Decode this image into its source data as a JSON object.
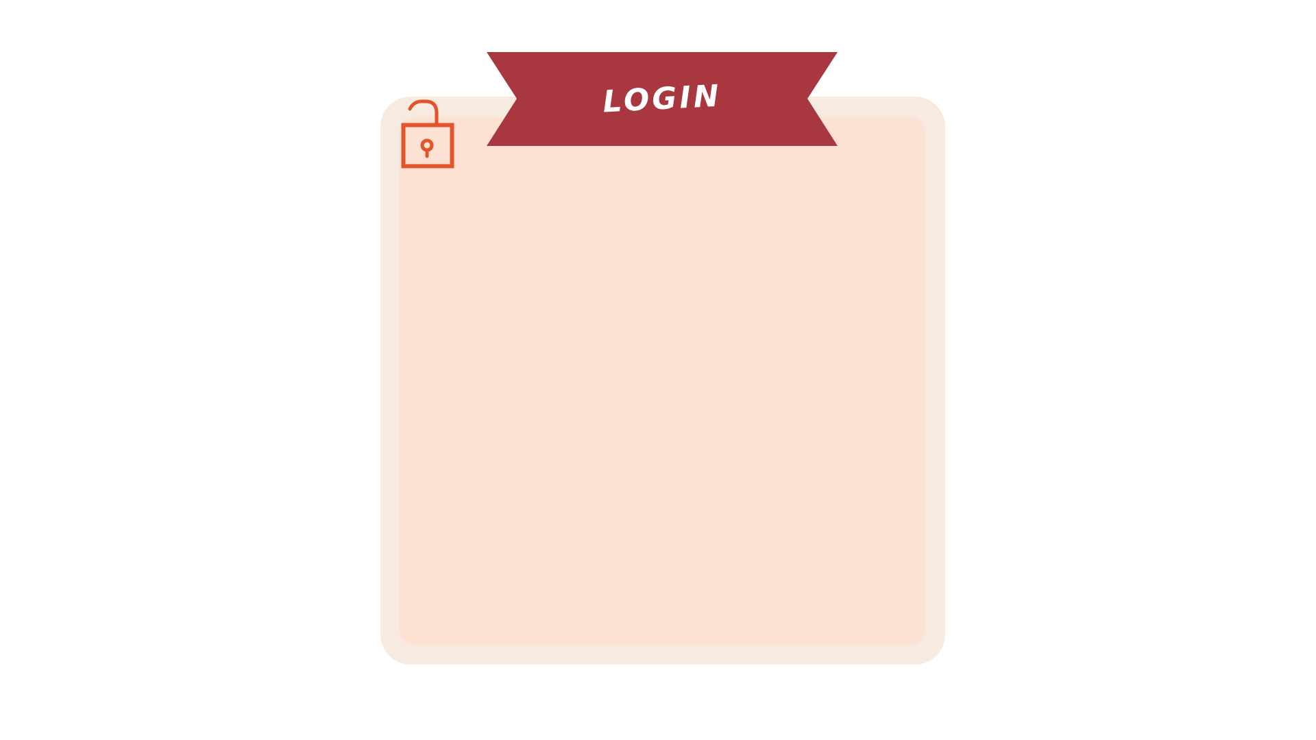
{
  "banner": {
    "title": "LOGIN"
  },
  "icons": {
    "lock": "unlocked-padlock-icon"
  },
  "colors": {
    "banner": "#a83740",
    "card_border": "#f7eae0",
    "card_fill": "#fde1d3",
    "lock": "#e2542c"
  }
}
